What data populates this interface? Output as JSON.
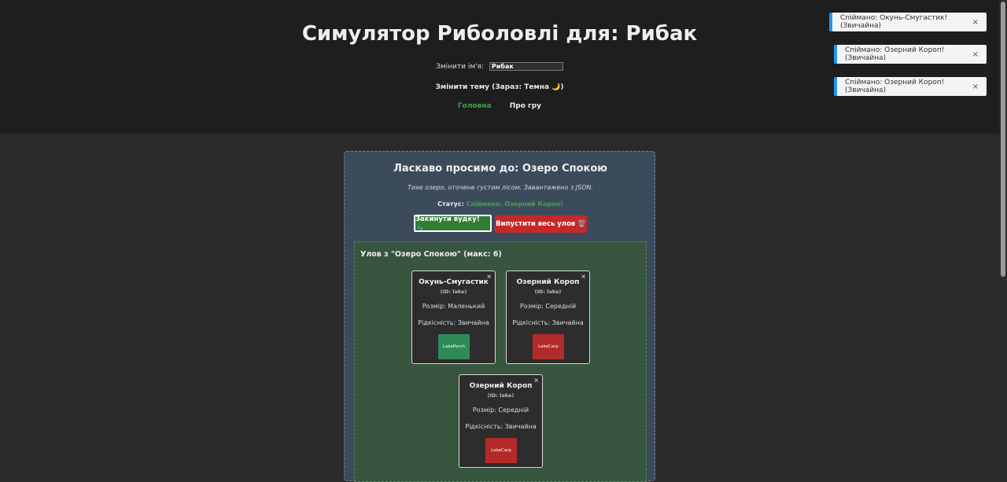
{
  "header": {
    "title": "Симулятор Риболовлі для: Рибак",
    "name_label": "Змінити ім'я:",
    "name_value": "Рибак",
    "theme_button": "Змінити тему (Зараз: Темна 🌙)",
    "nav": [
      {
        "label": "Головна",
        "active": true
      },
      {
        "label": "Про гру",
        "active": false
      }
    ]
  },
  "toasts": [
    {
      "text": "Спіймано: Окунь-Смугастик! (Звичайна)",
      "close": "×"
    },
    {
      "text": "Спіймано: Озерний Короп! (Звичайна)",
      "close": "×"
    },
    {
      "text": "Спіймано: Озерний Короп! (Звичайна)",
      "close": "×"
    }
  ],
  "location": {
    "title": "Ласкаво просимо до: Озеро Спокою",
    "description": "Тихе озеро, оточене густим лісом. Завантажено з JSON.",
    "status_label": "Статус:",
    "status_value": "Спіймано: Озерний Короп!",
    "cast_button": "Закинути вудку! 🎣",
    "release_button": "Випустити весь улов 🗑️"
  },
  "catch": {
    "title": "Улов з \"Озеро Спокою\" (макс: 6)",
    "fish": [
      {
        "name": "Окунь-Смугастик",
        "id": "(ID: lake)",
        "size": "Розмір: Маленький",
        "rarity": "Рідкісність: Звичайна",
        "image_label": "LakePerch",
        "image_color": "#2e8b57",
        "close": "×"
      },
      {
        "name": "Озерний Короп",
        "id": "(ID: lake)",
        "size": "Розмір: Середній",
        "rarity": "Рідкісність: Звичайна",
        "image_label": "LakeCarp",
        "image_color": "#b22a2a",
        "close": "×"
      },
      {
        "name": "Озерний Короп",
        "id": "(ID: lake)",
        "size": "Розмір: Середній",
        "rarity": "Рідкісність: Звичайна",
        "image_label": "LakeCarp",
        "image_color": "#b22a2a",
        "close": "×"
      }
    ]
  },
  "colors": {
    "accent_green": "#43a047",
    "toast_border": "#2196f3",
    "danger": "#c62828"
  }
}
